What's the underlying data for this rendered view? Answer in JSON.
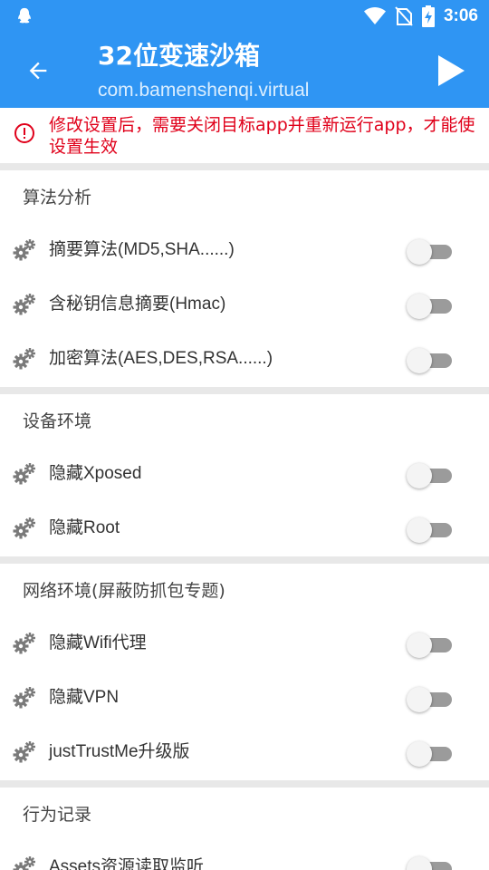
{
  "status_bar": {
    "time": "3:06",
    "icons": [
      "qq-icon",
      "wifi-icon",
      "no-sim-icon",
      "battery-charging-icon"
    ]
  },
  "header": {
    "title": "32位变速沙箱",
    "subtitle": "com.bamenshenqi.virtual",
    "back_icon": "arrow-left-icon",
    "play_icon": "play-icon"
  },
  "warning": {
    "icon": "error-circle-icon",
    "text": "修改设置后，需要关闭目标app并重新运行app，才能使设置生效"
  },
  "colors": {
    "primary": "#2f95f3",
    "warning": "#e0001a",
    "switch_track_off": "#9b9b9b"
  },
  "sections": [
    {
      "title": "算法分析",
      "items": [
        {
          "label": "摘要算法(MD5,SHA......)",
          "enabled": false
        },
        {
          "label": "含秘钥信息摘要(Hmac)",
          "enabled": false
        },
        {
          "label": "加密算法(AES,DES,RSA......)",
          "enabled": false
        }
      ]
    },
    {
      "title": "设备环境",
      "items": [
        {
          "label": "隐藏Xposed",
          "enabled": false
        },
        {
          "label": "隐藏Root",
          "enabled": false
        }
      ]
    },
    {
      "title": "网络环境(屏蔽防抓包专题)",
      "items": [
        {
          "label": "隐藏Wifi代理",
          "enabled": false
        },
        {
          "label": "隐藏VPN",
          "enabled": false
        },
        {
          "label": "justTrustMe升级版",
          "enabled": false
        }
      ]
    },
    {
      "title": "行为记录",
      "items": [
        {
          "label": "Assets资源读取监听",
          "enabled": false
        }
      ]
    }
  ]
}
